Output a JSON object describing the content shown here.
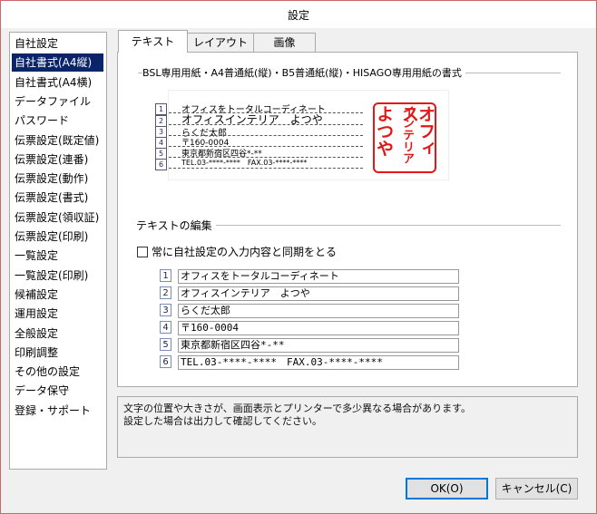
{
  "window": {
    "title": "設定"
  },
  "sidebar": {
    "selected_index": 1,
    "items": [
      "自社設定",
      "自社書式(A4縦)",
      "自社書式(A4横)",
      "データファイル",
      "パスワード",
      "伝票設定(既定値)",
      "伝票設定(連番)",
      "伝票設定(動作)",
      "伝票設定(書式)",
      "伝票設定(領収証)",
      "伝票設定(印刷)",
      "一覧設定",
      "一覧設定(印刷)",
      "候補設定",
      "運用設定",
      "全般設定",
      "印刷調整",
      "その他の設定",
      "データ保守",
      "登録・サポート"
    ]
  },
  "tabs": [
    "テキスト",
    "レイアウト",
    "画像"
  ],
  "active_tab": 0,
  "preview": {
    "group_title": "BSL専用用紙・A4普通紙(縦)・B5普通紙(縦)・HISAGO専用用紙の書式",
    "numbers": [
      "1",
      "2",
      "3",
      "4",
      "5",
      "6"
    ],
    "lines": [
      "オフィスをトータルコーディネート",
      "オフィスインテリア　よつや",
      "らくだ太郎",
      "〒160-0004",
      "東京都新宿区四谷*-**",
      "TEL.03-****-****　FAX.03-****-****"
    ],
    "stamp": {
      "col1": "オフィス",
      "col2": "インテリア",
      "col3": "よつや",
      "color": "#e01818"
    }
  },
  "edit": {
    "group_title": "テキストの編集",
    "sync_checkbox_label": "常に自社設定の入力内容と同期をとる",
    "sync_checked": false,
    "numbers": [
      "1",
      "2",
      "3",
      "4",
      "5",
      "6"
    ],
    "fields": [
      "オフィスをトータルコーディネート",
      "オフィスインテリア　よつや",
      "らくだ太郎",
      "〒160-0004",
      "東京都新宿区四谷*-**",
      "TEL.03-****-****　FAX.03-****-****"
    ]
  },
  "note": {
    "line1": "文字の位置や大きさが、画面表示とプリンターで多少異なる場合があります。",
    "line2": "設定した場合は出力して確認してください。"
  },
  "buttons": {
    "ok": "OK(O)",
    "cancel": "キャンセル(C)"
  },
  "colors": {
    "selection": "#0a246a",
    "stamp_red": "#e01818",
    "default_button_border": "#0078d7"
  }
}
